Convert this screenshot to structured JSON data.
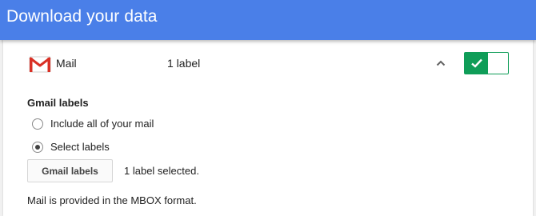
{
  "header": {
    "title": "Download your data"
  },
  "product": {
    "icon": "gmail-icon",
    "name": "Mail",
    "label_summary": "1 label",
    "expanded": true,
    "included": true,
    "colors": {
      "accent": "#0f9d58",
      "header": "#4a7fe8",
      "logo_red": "#d93025"
    }
  },
  "options": {
    "section_title": "Gmail labels",
    "radios": [
      {
        "label": "Include all of your mail",
        "selected": false
      },
      {
        "label": "Select labels",
        "selected": true
      }
    ],
    "labels_button": "Gmail labels",
    "selected_count": "1 label selected.",
    "format_note": "Mail is provided in the MBOX format."
  }
}
